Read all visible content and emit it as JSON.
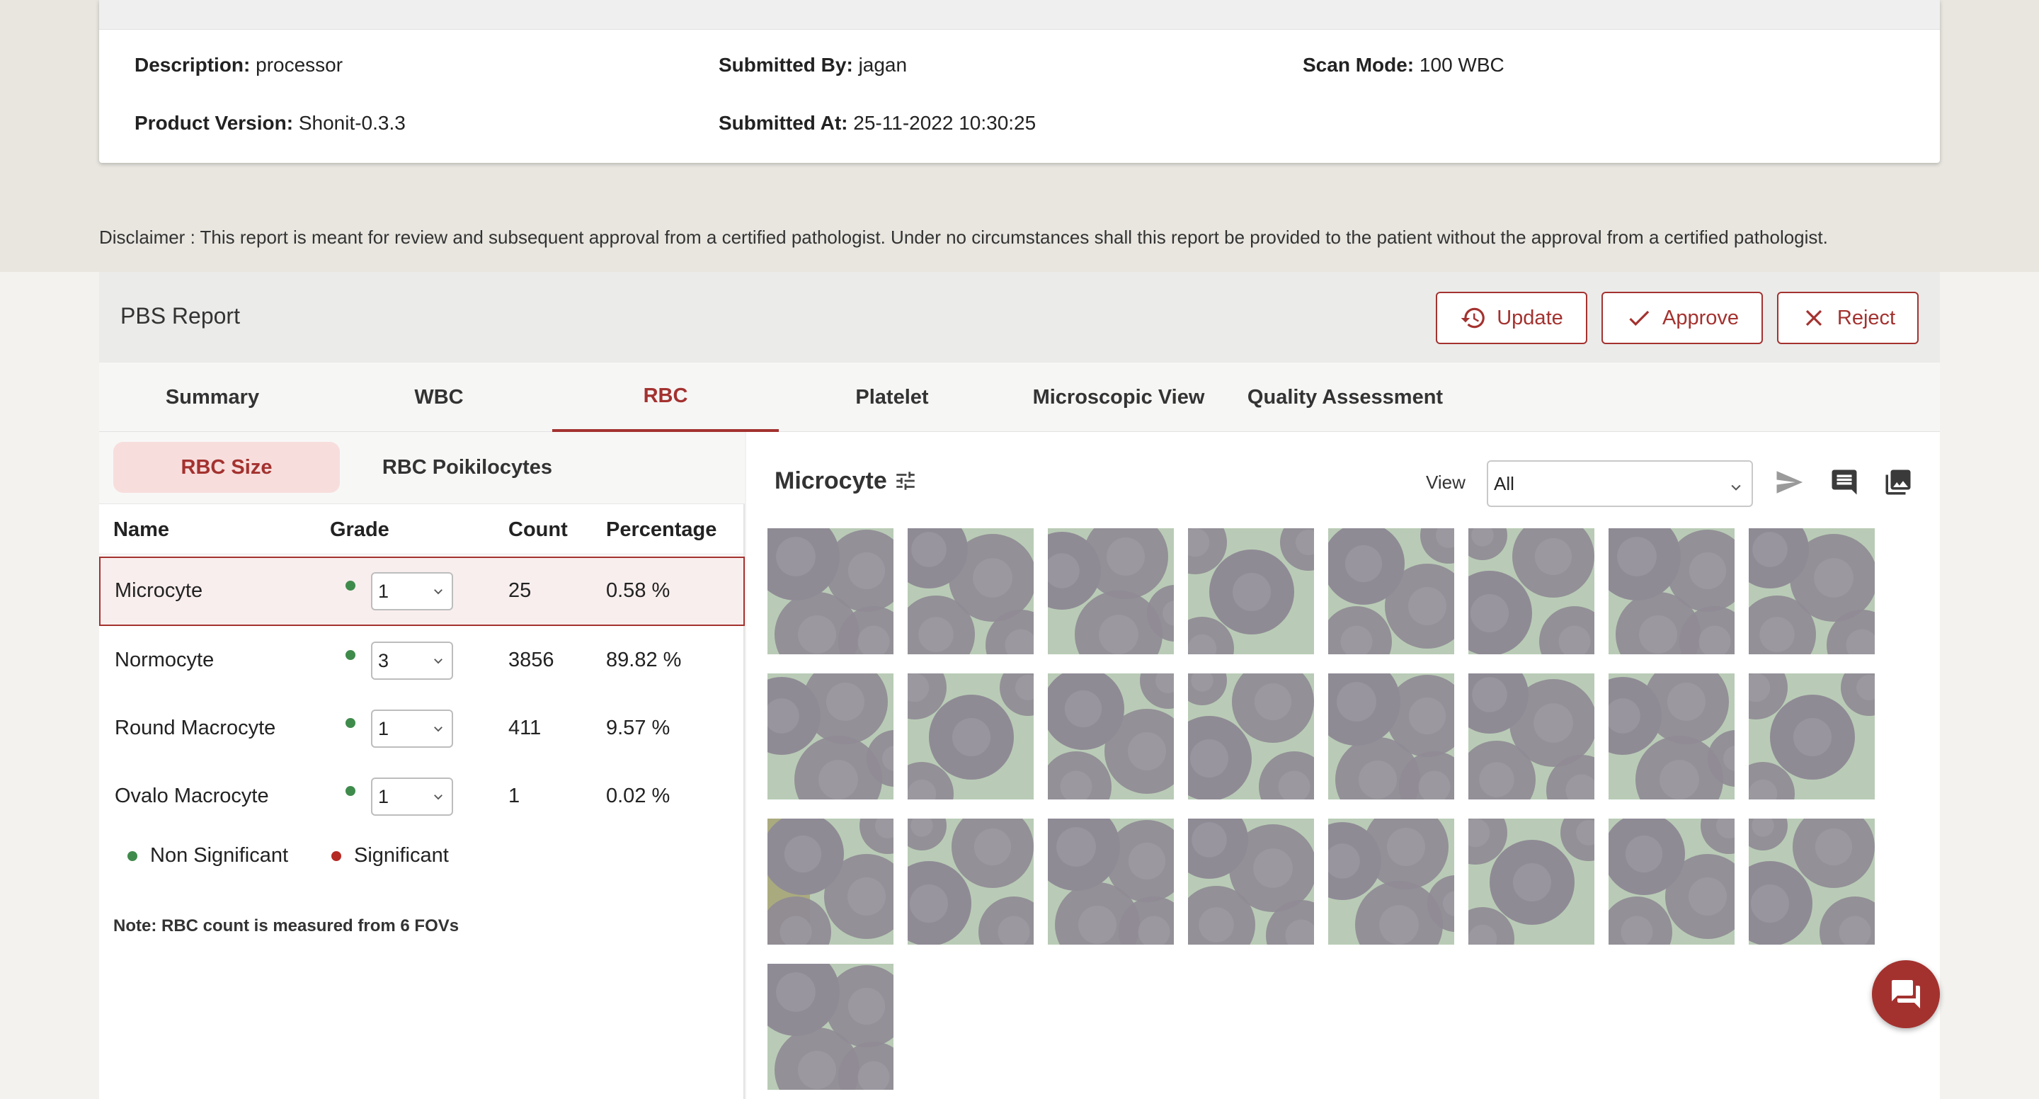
{
  "info": {
    "description_label": "Description:",
    "description_value": "processor",
    "submitted_by_label": "Submitted By:",
    "submitted_by_value": "jagan",
    "scan_mode_label": "Scan Mode:",
    "scan_mode_value": "100 WBC",
    "product_version_label": "Product Version:",
    "product_version_value": "Shonit-0.3.3",
    "submitted_at_label": "Submitted At:",
    "submitted_at_value": "25-11-2022 10:30:25"
  },
  "disclaimer": "Disclaimer :  This report is meant for review and subsequent approval from a certified pathologist. Under no circumstances shall this report be provided to the patient without the approval from a certified pathologist.",
  "report": {
    "title": "PBS Report",
    "update_label": "Update",
    "approve_label": "Approve",
    "reject_label": "Reject"
  },
  "tabs": [
    {
      "label": "Summary"
    },
    {
      "label": "WBC"
    },
    {
      "label": "RBC"
    },
    {
      "label": "Platelet"
    },
    {
      "label": "Microscopic View"
    },
    {
      "label": "Quality Assessment"
    }
  ],
  "active_tab": "RBC",
  "subtabs": [
    {
      "label": "RBC Size"
    },
    {
      "label": "RBC Poikilocytes"
    }
  ],
  "table": {
    "headers": {
      "name": "Name",
      "grade": "Grade",
      "count": "Count",
      "percentage": "Percentage"
    },
    "rows": [
      {
        "name": "Microcyte",
        "grade": "1",
        "count": "25",
        "percentage": "0.58 %"
      },
      {
        "name": "Normocyte",
        "grade": "3",
        "count": "3856",
        "percentage": "89.82 %"
      },
      {
        "name": "Round Macrocyte",
        "grade": "1",
        "count": "411",
        "percentage": "9.57 %"
      },
      {
        "name": "Ovalo Macrocyte",
        "grade": "1",
        "count": "1",
        "percentage": "0.02 %"
      }
    ],
    "selected_row": "Microcyte"
  },
  "legend": {
    "non_significant": "Non Significant",
    "significant": "Significant"
  },
  "note": "Note: RBC count is measured from 6 FOVs",
  "gallery": {
    "title": "Microcyte",
    "view_label": "View",
    "view_value": "All",
    "image_count": 25
  },
  "colors": {
    "accent": "#a3322f",
    "non_significant": "#3f8b4c",
    "significant": "#b52a25",
    "thumb_bg": "#b9cbb6",
    "cell": "#8f8b95"
  },
  "icons": {
    "update": "history-icon",
    "approve": "check-icon",
    "reject": "close-icon",
    "filter": "tune-icon",
    "send": "send-icon",
    "comment": "comment-icon",
    "gallery": "photo-library-icon",
    "chat": "chat-icon"
  }
}
